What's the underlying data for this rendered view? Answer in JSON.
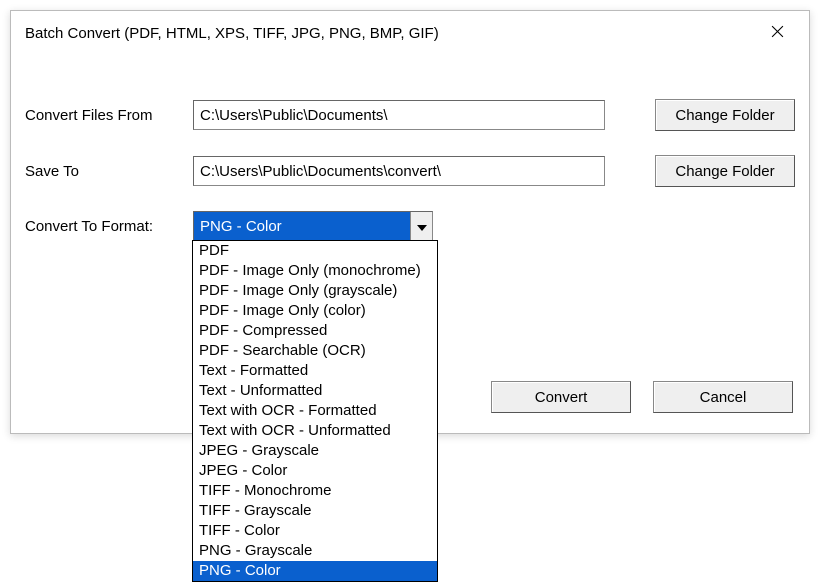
{
  "window": {
    "title": "Batch Convert (PDF, HTML, XPS, TIFF, JPG, PNG, BMP, GIF)"
  },
  "labels": {
    "convert_from": "Convert Files From",
    "save_to": "Save To",
    "convert_format": "Convert To Format:"
  },
  "paths": {
    "from": "C:\\Users\\Public\\Documents\\",
    "to": "C:\\Users\\Public\\Documents\\convert\\"
  },
  "buttons": {
    "change_folder": "Change Folder",
    "convert": "Convert",
    "cancel": "Cancel"
  },
  "format": {
    "selected": "PNG - Color",
    "options": [
      "PDF",
      "PDF - Image Only (monochrome)",
      "PDF - Image Only (grayscale)",
      "PDF - Image Only (color)",
      "PDF - Compressed",
      "PDF - Searchable (OCR)",
      "Text - Formatted",
      "Text - Unformatted",
      "Text with OCR - Formatted",
      "Text with OCR - Unformatted",
      "JPEG - Grayscale",
      "JPEG - Color",
      "TIFF - Monochrome",
      "TIFF - Grayscale",
      "TIFF - Color",
      "PNG - Grayscale",
      "PNG - Color"
    ]
  }
}
